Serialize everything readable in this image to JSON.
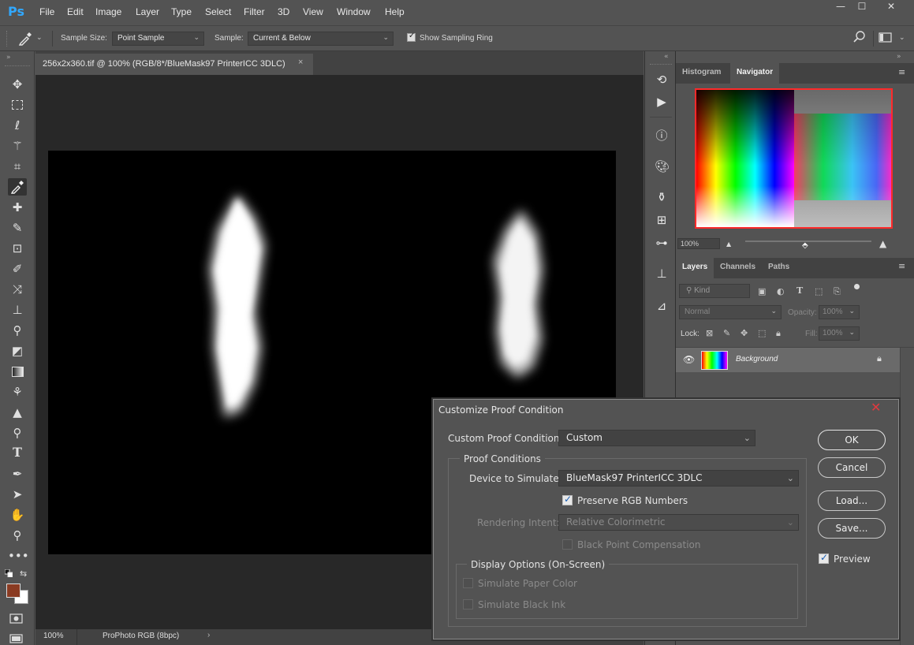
{
  "app": {
    "logo": "Ps"
  },
  "menu": [
    "File",
    "Edit",
    "Image",
    "Layer",
    "Type",
    "Select",
    "Filter",
    "3D",
    "View",
    "Window",
    "Help"
  ],
  "window_controls": {
    "minimize": "—",
    "maximize": "☐",
    "close": "✕"
  },
  "options_bar": {
    "sample_size_label": "Sample Size:",
    "sample_size_value": "Point Sample",
    "sample_label": "Sample:",
    "sample_value": "Current & Below",
    "show_sampling_ring_label": "Show Sampling Ring",
    "show_sampling_ring_checked": true
  },
  "document": {
    "tab_title": "256x2x360.tif @ 100% (RGB/8*/BlueMask97 PrinterICC 3DLC)",
    "tab_close": "×",
    "zoom": "100%",
    "profile": "ProPhoto RGB (8bpc)",
    "status_arrow": "›"
  },
  "panels": {
    "top_tabs": [
      "Histogram",
      "Navigator"
    ],
    "active_top_tab": "Navigator",
    "navigator_zoom": "100%",
    "layer_tabs": [
      "Layers",
      "Channels",
      "Paths"
    ],
    "active_layer_tab": "Layers",
    "kind_placeholder": "Kind",
    "blend_mode": "Normal",
    "opacity_label": "Opacity:",
    "opacity_value": "100%",
    "lock_label": "Lock:",
    "fill_label": "Fill:",
    "fill_value": "100%",
    "layers": [
      {
        "name": "Background",
        "visible": true,
        "locked": true
      }
    ]
  },
  "dialog": {
    "title": "Customize Proof Condition",
    "custom_proof_label": "Custom Proof Condition:",
    "custom_proof_value": "Custom",
    "proof_conditions_label": "Proof Conditions",
    "device_label": "Device to Simulate:",
    "device_value": "BlueMask97 PrinterICC 3DLC",
    "preserve_rgb_label": "Preserve RGB Numbers",
    "preserve_rgb_checked": true,
    "rendering_intent_label": "Rendering Intent:",
    "rendering_intent_value": "Relative Colorimetric",
    "black_point_label": "Black Point Compensation",
    "black_point_checked": false,
    "display_options_label": "Display Options (On-Screen)",
    "simulate_paper_label": "Simulate Paper Color",
    "simulate_ink_label": "Simulate Black Ink",
    "buttons": {
      "ok": "OK",
      "cancel": "Cancel",
      "load": "Load...",
      "save": "Save..."
    },
    "preview_label": "Preview",
    "preview_checked": true
  },
  "colors": {
    "accent": "#31a8ff",
    "foreground_swatch": "#8a3b22",
    "background_swatch": "#ffffff",
    "dialog_close": "#e0393e"
  }
}
